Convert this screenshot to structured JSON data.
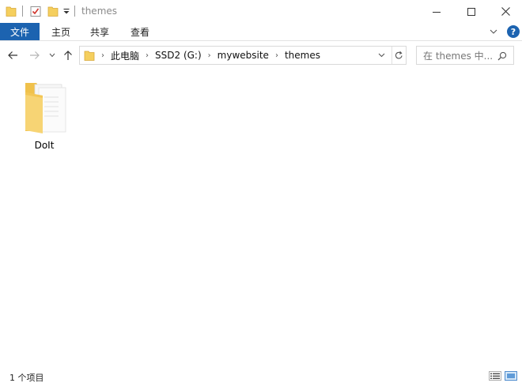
{
  "window": {
    "title": "themes",
    "controls": {
      "minimize_icon": "minimize-icon",
      "maximize_icon": "maximize-icon",
      "close_icon": "close-icon"
    }
  },
  "quick_access": [
    "folder-icon",
    "properties-icon",
    "new-folder-icon",
    "dropdown-icon"
  ],
  "ribbon": {
    "file_tab": "文件",
    "tabs": [
      "主页",
      "共享",
      "查看"
    ],
    "help_label": "?"
  },
  "address": {
    "breadcrumbs": [
      "此电脑",
      "SSD2 (G:)",
      "mywebsite",
      "themes"
    ]
  },
  "search": {
    "placeholder": "在 themes 中..."
  },
  "items": [
    {
      "name": "DoIt",
      "type": "folder"
    }
  ],
  "status": {
    "count": "1 个项目"
  },
  "colors": {
    "accent": "#1c63b0",
    "folder": "#f7d474"
  }
}
